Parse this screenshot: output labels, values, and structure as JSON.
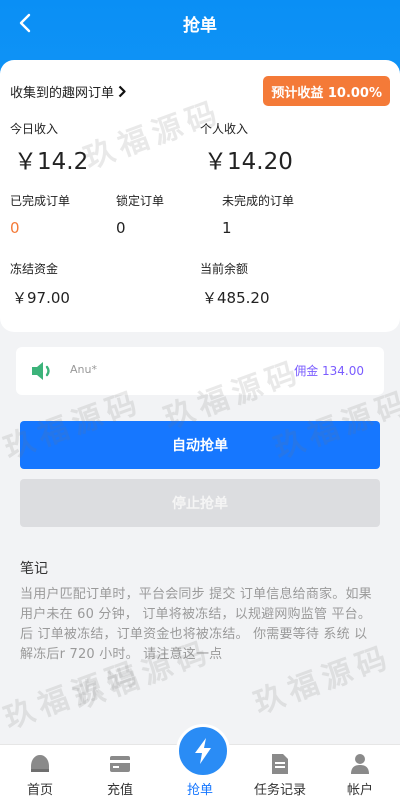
{
  "header": {
    "title": "抢单"
  },
  "summary": {
    "collected_link": "收集到的趣网订单",
    "expected_badge": "预计收益 10.00%",
    "today_income_label": "今日收入",
    "today_income_value": "￥14.2",
    "personal_income_label": "个人收入",
    "personal_income_value": "￥14.20",
    "completed_label": "已完成订单",
    "completed_value": "0",
    "locked_label": "锁定订单",
    "locked_value": "0",
    "incomplete_label": "未完成的订单",
    "incomplete_value": "1",
    "frozen_label": "冻结资金",
    "frozen_value": "￥97.00",
    "balance_label": "当前余额",
    "balance_value": "￥485.20"
  },
  "ticker": {
    "user": "Anu*",
    "commission": "佣金 134.00"
  },
  "buttons": {
    "auto": "自动抢单",
    "stop": "停止抢单"
  },
  "notes": {
    "title": "笔记",
    "text": "当用户匹配订单时，平台会同步 提交 订单信息给商家。如果用户未在 60 分钟， 订单将被冻结，以规避网购监管 平台。 后 订单被冻结，订单资金也将被冻结。 你需要等待 系统 以 解冻后r 720 小时。 请注意这一点"
  },
  "tabbar": {
    "home": "首页",
    "recharge": "充值",
    "grab": "抢单",
    "tasks": "任务记录",
    "account": "帐户"
  },
  "watermark": "玖福源码",
  "colors": {
    "primary": "#1677ff",
    "header": "#0a8ff5",
    "badge": "#f47a38",
    "commission": "#7a5cff"
  },
  "icons": [
    "back-arrow-icon",
    "chevron-right-icon",
    "speaker-icon",
    "home-icon",
    "wallet-icon",
    "lightning-icon",
    "document-icon",
    "user-icon"
  ]
}
